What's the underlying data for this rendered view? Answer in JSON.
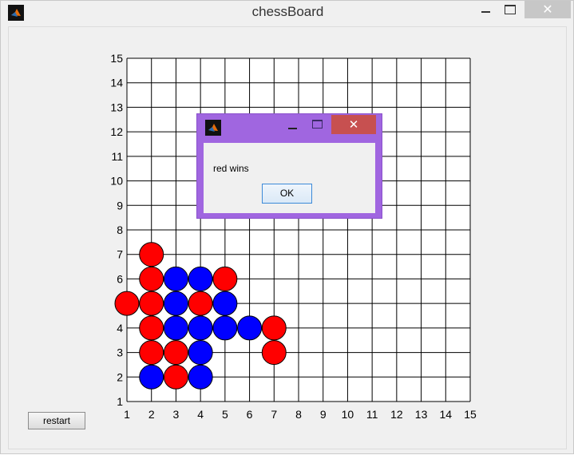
{
  "window": {
    "title": "chessBoard",
    "icon": "matlab-icon",
    "controls": {
      "minimize": "minimize-icon",
      "maximize": "maximize-icon",
      "close": "✕"
    }
  },
  "board": {
    "x_ticks": [
      "1",
      "2",
      "3",
      "4",
      "5",
      "6",
      "7",
      "8",
      "9",
      "10",
      "11",
      "12",
      "13",
      "14",
      "15"
    ],
    "y_ticks": [
      "1",
      "2",
      "3",
      "4",
      "5",
      "6",
      "7",
      "8",
      "9",
      "10",
      "11",
      "12",
      "13",
      "14",
      "15"
    ],
    "xlim": [
      1,
      15
    ],
    "ylim": [
      1,
      15
    ],
    "grid": true,
    "colors": {
      "red": "#ff0000",
      "blue": "#0000ff",
      "line": "#000000"
    },
    "pieces": [
      {
        "x": 1,
        "y": 5,
        "color": "red"
      },
      {
        "x": 2,
        "y": 7,
        "color": "red"
      },
      {
        "x": 2,
        "y": 6,
        "color": "red"
      },
      {
        "x": 2,
        "y": 5,
        "color": "red"
      },
      {
        "x": 2,
        "y": 4,
        "color": "red"
      },
      {
        "x": 2,
        "y": 3,
        "color": "red"
      },
      {
        "x": 2,
        "y": 2,
        "color": "blue"
      },
      {
        "x": 3,
        "y": 6,
        "color": "blue"
      },
      {
        "x": 3,
        "y": 5,
        "color": "blue"
      },
      {
        "x": 3,
        "y": 4,
        "color": "blue"
      },
      {
        "x": 3,
        "y": 3,
        "color": "red"
      },
      {
        "x": 3,
        "y": 2,
        "color": "red"
      },
      {
        "x": 4,
        "y": 6,
        "color": "blue"
      },
      {
        "x": 4,
        "y": 5,
        "color": "red"
      },
      {
        "x": 4,
        "y": 4,
        "color": "blue"
      },
      {
        "x": 4,
        "y": 3,
        "color": "blue"
      },
      {
        "x": 4,
        "y": 2,
        "color": "blue"
      },
      {
        "x": 5,
        "y": 6,
        "color": "red"
      },
      {
        "x": 5,
        "y": 5,
        "color": "blue"
      },
      {
        "x": 5,
        "y": 4,
        "color": "blue"
      },
      {
        "x": 6,
        "y": 4,
        "color": "blue"
      },
      {
        "x": 7,
        "y": 4,
        "color": "red"
      },
      {
        "x": 7,
        "y": 3,
        "color": "red"
      }
    ]
  },
  "restart_label": "restart",
  "dialog": {
    "message": "red wins",
    "ok_label": "OK",
    "icon": "matlab-icon",
    "close": "✕",
    "title_color": "#a066e0",
    "close_color": "#c75050"
  }
}
